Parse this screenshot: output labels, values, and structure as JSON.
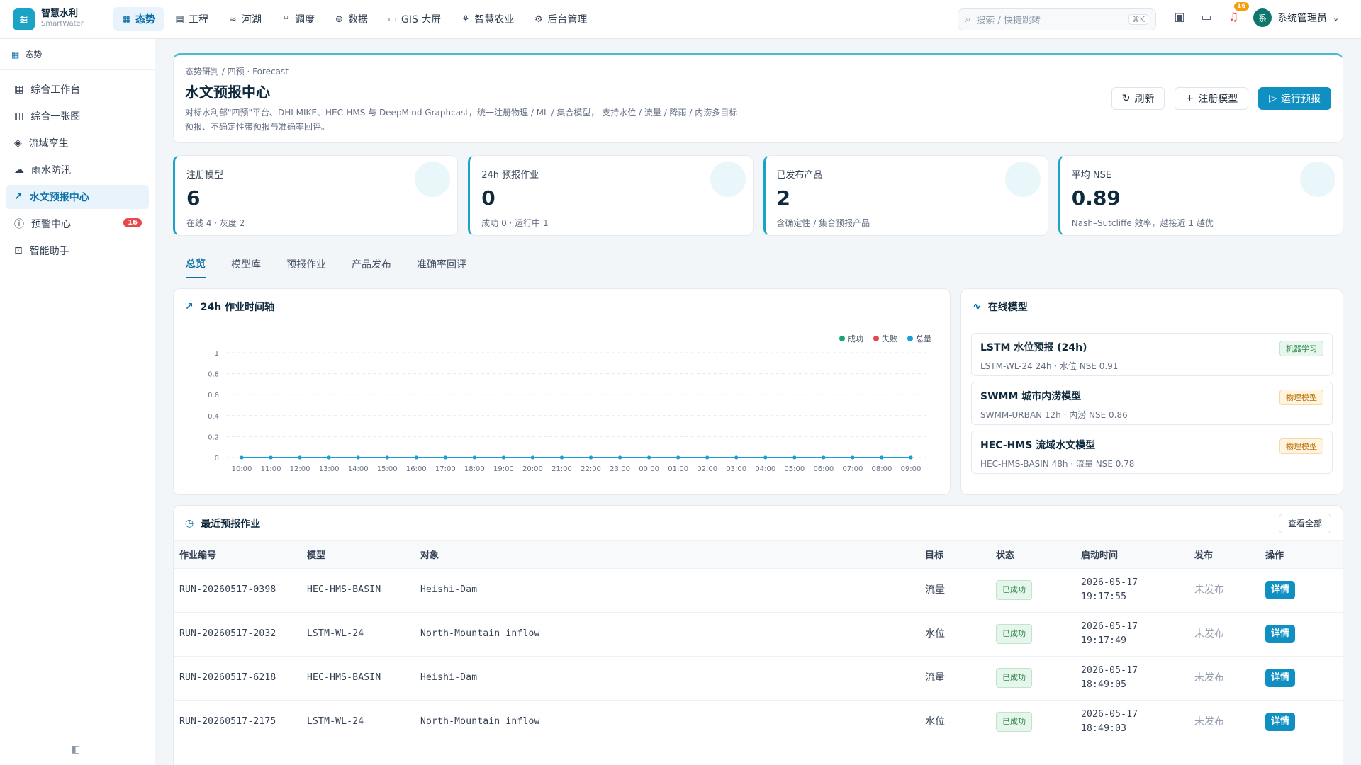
{
  "brand": {
    "name": "智慧水利",
    "sub": "SmartWater",
    "logo_icon": "waves-icon"
  },
  "nav": [
    {
      "label": "态势",
      "icon": "grid-icon",
      "active": true
    },
    {
      "label": "工程",
      "icon": "building-icon",
      "active": false
    },
    {
      "label": "河湖",
      "icon": "waves-icon",
      "active": false
    },
    {
      "label": "调度",
      "icon": "branch-icon",
      "active": false
    },
    {
      "label": "数据",
      "icon": "database-icon",
      "active": false
    },
    {
      "label": "GIS 大屏",
      "icon": "monitor-icon",
      "active": false
    },
    {
      "label": "智慧农业",
      "icon": "sprout-icon",
      "active": false
    },
    {
      "label": "后台管理",
      "icon": "gear-icon",
      "active": false
    }
  ],
  "search": {
    "placeholder": "搜索 / 快捷跳转",
    "shortcut": "⌘K"
  },
  "notifications": {
    "count": "16"
  },
  "user": {
    "name": "系统管理员",
    "avatar": "系"
  },
  "sidebar": {
    "header": "态势",
    "items": [
      {
        "label": "综合工作台",
        "icon": "dashboard-icon",
        "active": false
      },
      {
        "label": "综合一张图",
        "icon": "map-icon",
        "active": false
      },
      {
        "label": "流域孪生",
        "icon": "layers-icon",
        "active": false
      },
      {
        "label": "雨水防汛",
        "icon": "cloud-rain-icon",
        "active": false
      },
      {
        "label": "水文预报中心",
        "icon": "chart-line-icon",
        "active": true
      },
      {
        "label": "预警中心",
        "icon": "alert-circle-icon",
        "active": false,
        "badge": "16"
      },
      {
        "label": "智能助手",
        "icon": "bot-icon",
        "active": false
      }
    ]
  },
  "hero": {
    "breadcrumb": "态势研判 / 四预 · Forecast",
    "title": "水文预报中心",
    "description": "对标水利部\"四预\"平台、DHI MIKE、HEC-HMS 与 DeepMind Graphcast，统一注册物理 / ML / 集合模型， 支持水位 / 流量 / 降雨 / 内涝多目标预报、不确定性带预报与准确率回评。",
    "refresh": "刷新",
    "register": "注册模型",
    "run": "运行预报"
  },
  "kpis": [
    {
      "label": "注册模型",
      "value": "6",
      "sub": "在线 4 · 灰度 2"
    },
    {
      "label": "24h 预报作业",
      "value": "0",
      "sub": "成功 0 · 运行中 1"
    },
    {
      "label": "已发布产品",
      "value": "2",
      "sub": "含确定性 / 集合预报产品"
    },
    {
      "label": "平均 NSE",
      "value": "0.89",
      "sub": "Nash–Sutcliffe 效率，越接近 1 越优"
    }
  ],
  "tabs": [
    "总览",
    "模型库",
    "预报作业",
    "产品发布",
    "准确率回评"
  ],
  "timeline": {
    "title": "24h 作业时间轴"
  },
  "chart_data": {
    "type": "line",
    "title": "24h 作业时间轴",
    "categories": [
      "10:00",
      "11:00",
      "12:00",
      "13:00",
      "14:00",
      "15:00",
      "16:00",
      "17:00",
      "18:00",
      "19:00",
      "20:00",
      "21:00",
      "22:00",
      "23:00",
      "00:00",
      "01:00",
      "02:00",
      "03:00",
      "04:00",
      "05:00",
      "06:00",
      "07:00",
      "08:00",
      "09:00"
    ],
    "series": [
      {
        "name": "成功",
        "color": "#1aa37a",
        "values": [
          0,
          0,
          0,
          0,
          0,
          0,
          0,
          0,
          0,
          0,
          0,
          0,
          0,
          0,
          0,
          0,
          0,
          0,
          0,
          0,
          0,
          0,
          0,
          0
        ]
      },
      {
        "name": "失败",
        "color": "#e5484d",
        "values": [
          0,
          0,
          0,
          0,
          0,
          0,
          0,
          0,
          0,
          0,
          0,
          0,
          0,
          0,
          0,
          0,
          0,
          0,
          0,
          0,
          0,
          0,
          0,
          0
        ]
      },
      {
        "name": "总量",
        "color": "#1a9ed8",
        "values": [
          0,
          0,
          0,
          0,
          0,
          0,
          0,
          0,
          0,
          0,
          0,
          0,
          0,
          0,
          0,
          0,
          0,
          0,
          0,
          0,
          0,
          0,
          0,
          0
        ]
      }
    ],
    "yticks": [
      "0",
      "0.2",
      "0.4",
      "0.6",
      "0.8",
      "1"
    ],
    "ylim": [
      0,
      1
    ],
    "legend": "top-right",
    "grid": true
  },
  "online_models": {
    "title": "在线模型",
    "items": [
      {
        "name": "LSTM 水位预报 (24h)",
        "meta": "LSTM-WL-24   24h · 水位   NSE 0.91",
        "tag": "机器学习",
        "tag_color": "green"
      },
      {
        "name": "SWMM 城市内涝模型",
        "meta": "SWMM-URBAN   12h · 内涝   NSE 0.86",
        "tag": "物理模型",
        "tag_color": "amber"
      },
      {
        "name": "HEC-HMS 流域水文模型",
        "meta": "HEC-HMS-BASIN   48h · 流量   NSE 0.78",
        "tag": "物理模型",
        "tag_color": "amber"
      }
    ]
  },
  "runs": {
    "title": "最近预报作业",
    "view_all": "查看全部",
    "columns": [
      "作业编号",
      "模型",
      "对象",
      "目标",
      "状态",
      "启动时间",
      "发布",
      "操作"
    ],
    "rows": [
      {
        "id": "RUN-20260517-0398",
        "model": "HEC-HMS-BASIN",
        "object": "Heishi-Dam",
        "target": "流量",
        "status": "已成功",
        "date": "2026-05-17",
        "time": "19:17:55",
        "publish": "未发布",
        "action": "详情"
      },
      {
        "id": "RUN-20260517-2032",
        "model": "LSTM-WL-24",
        "object": "North-Mountain inflow",
        "target": "水位",
        "status": "已成功",
        "date": "2026-05-17",
        "time": "19:17:49",
        "publish": "未发布",
        "action": "详情"
      },
      {
        "id": "RUN-20260517-6218",
        "model": "HEC-HMS-BASIN",
        "object": "Heishi-Dam",
        "target": "流量",
        "status": "已成功",
        "date": "2026-05-17",
        "time": "18:49:05",
        "publish": "未发布",
        "action": "详情"
      },
      {
        "id": "RUN-20260517-2175",
        "model": "LSTM-WL-24",
        "object": "North-Mountain inflow",
        "target": "水位",
        "status": "已成功",
        "date": "2026-05-17",
        "time": "18:49:03",
        "publish": "未发布",
        "action": "详情"
      }
    ]
  }
}
